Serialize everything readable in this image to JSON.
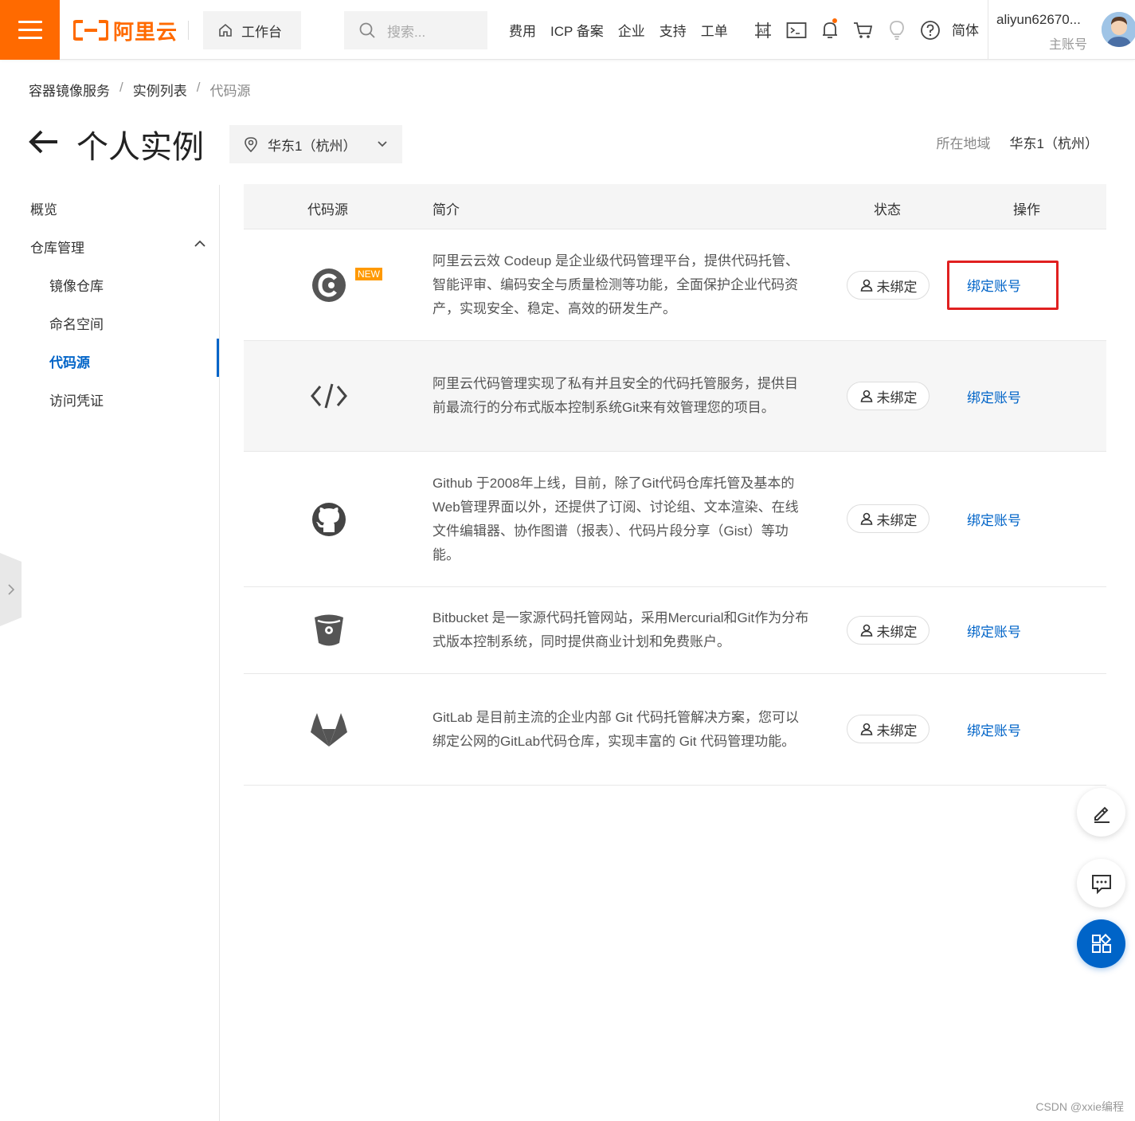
{
  "topbar": {
    "brand": "阿里云",
    "workbench": "工作台",
    "search_placeholder": "搜索...",
    "nav": [
      "费用",
      "ICP 备案",
      "企业",
      "支持",
      "工单"
    ],
    "icons": [
      "api-icon",
      "terminal-icon",
      "bell-icon",
      "cart-icon",
      "lightbulb-icon",
      "help-icon"
    ],
    "language": "简体",
    "user_name": "aliyun62670...",
    "user_role": "主账号"
  },
  "breadcrumb": {
    "items": [
      "容器镜像服务",
      "实例列表"
    ],
    "current": "代码源",
    "separator": "/"
  },
  "header": {
    "title": "个人实例",
    "region_select": "华东1（杭州）",
    "region_label": "所在地域",
    "region_value": "华东1（杭州）"
  },
  "sidebar": {
    "overview": "概览",
    "group": "仓库管理",
    "items": [
      "镜像仓库",
      "命名空间",
      "代码源",
      "访问凭证"
    ],
    "active_item": "代码源"
  },
  "table": {
    "columns": [
      "代码源",
      "简介",
      "状态",
      "操作"
    ],
    "rows": [
      {
        "icon": "codeup-icon",
        "badge": "NEW",
        "description": "阿里云云效 Codeup 是企业级代码管理平台，提供代码托管、智能评审、编码安全与质量检测等功能，全面保护企业代码资产，实现安全、稳定、高效的研发生产。",
        "status": "未绑定",
        "action": "绑定账号"
      },
      {
        "icon": "code-icon",
        "description": "阿里云代码管理实现了私有并且安全的代码托管服务，提供目前最流行的分布式版本控制系统Git来有效管理您的项目。",
        "status": "未绑定",
        "action": "绑定账号"
      },
      {
        "icon": "github-icon",
        "description": "Github 于2008年上线，目前，除了Git代码仓库托管及基本的Web管理界面以外，还提供了订阅、讨论组、文本渲染、在线文件编辑器、协作图谱（报表）、代码片段分享（Gist）等功能。",
        "status": "未绑定",
        "action": "绑定账号"
      },
      {
        "icon": "bitbucket-icon",
        "description": "Bitbucket 是一家源代码托管网站，采用Mercurial和Git作为分布式版本控制系统，同时提供商业计划和免费账户。",
        "status": "未绑定",
        "action": "绑定账号"
      },
      {
        "icon": "gitlab-icon",
        "description": "GitLab 是目前主流的企业内部 Git 代码托管解决方案，您可以绑定公网的GitLab代码仓库，实现丰富的 Git 代码管理功能。",
        "status": "未绑定",
        "action": "绑定账号"
      }
    ]
  },
  "watermark": "CSDN @xxie编程",
  "colors": {
    "brand": "#ff6a00",
    "link": "#0064c8",
    "highlight": "#e02020"
  }
}
